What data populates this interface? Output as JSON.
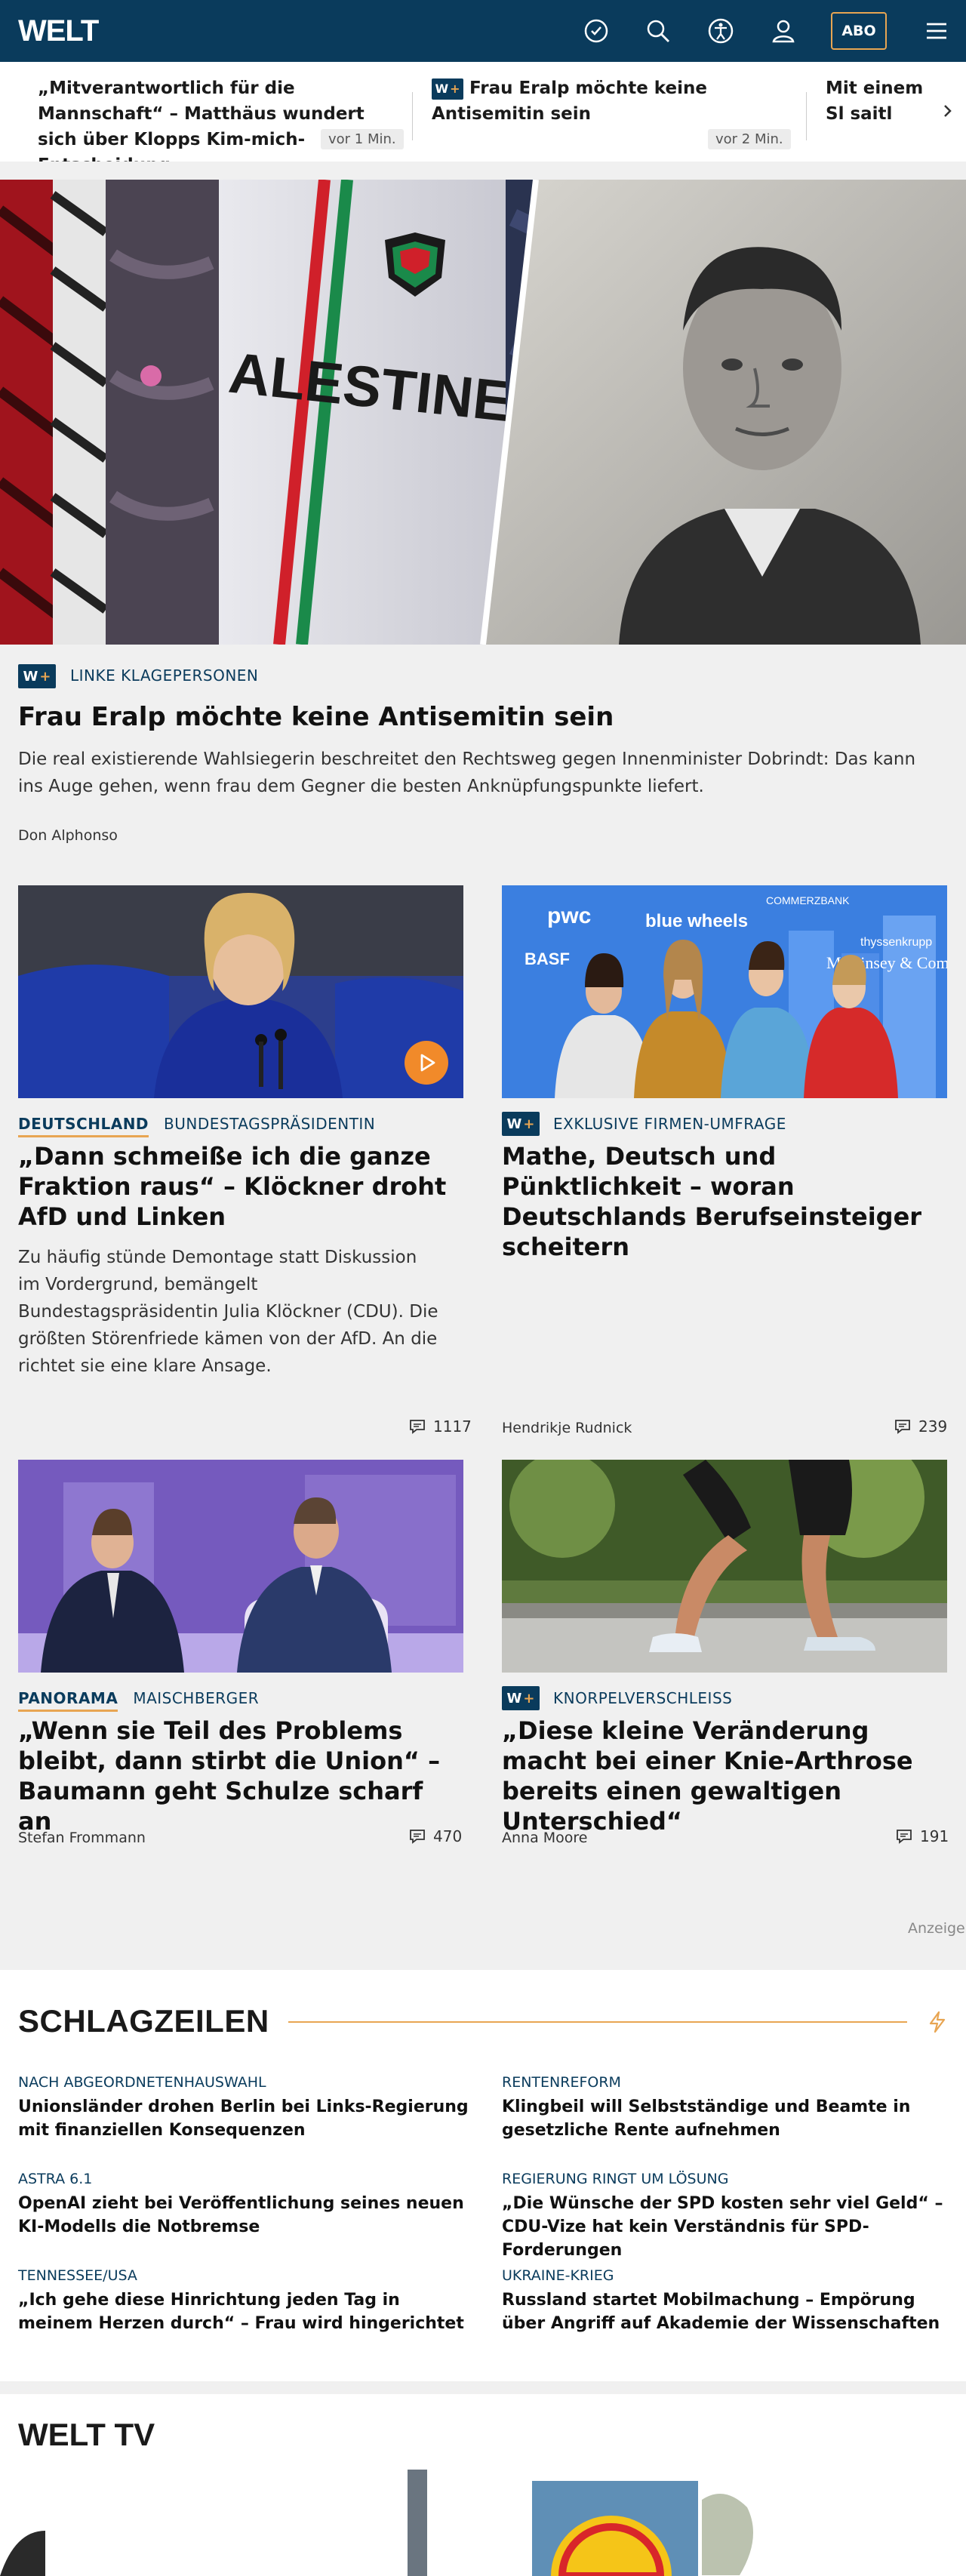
{
  "header": {
    "logo": "WELT",
    "abo_label": "ABO",
    "icons": [
      "clock-icon",
      "search-icon",
      "accessibility-icon",
      "user-icon",
      "menu-icon"
    ]
  },
  "ticker": [
    {
      "text": "„Mitverantwortlich für die Mannschaft“ – Matthäus wundert sich über Klopps Kim-mich-Entscheidung",
      "time": "vor 1 Min.",
      "premium": false
    },
    {
      "text": "Frau Eralp möchte keine Antisemitin sein",
      "time": "vor 2 Min.",
      "premium": true
    },
    {
      "text": "Mit einem Sl saitl seinen g",
      "time": "",
      "premium": false
    }
  ],
  "hero": {
    "premium_badge": "W+",
    "kicker": "LINKE KLAGEPERSONEN",
    "headline": "Frau Eralp möchte keine Antisemitin sein",
    "teaser": "Die real existierende Wahlsiegerin beschreitet den Rechtsweg gegen Innenminister Dobrindt: Das kann ins Auge gehen, wenn frau dem Gegner die besten Anknüpfungspunkte liefert.",
    "author": "Don Alphonso",
    "jersey_text": "ALESTINE"
  },
  "cards": [
    {
      "section": "DEUTSCHLAND",
      "kicker": "BUNDESTAGSPRÄSIDENTIN",
      "headline": "„Dann schmeiße ich die ganze Fraktion raus“ – Klöckner droht AfD und Linken",
      "teaser": "Zu häufig stünde Demontage statt Diskussion im Vordergrund, bemängelt Bundestagspräsidentin Julia Klöckner (CDU). Die größten Störenfriede kämen von der AfD. An die richtet sie eine klare Ansage.",
      "author": "",
      "comments": "1117",
      "video": true
    },
    {
      "section": "",
      "premium_badge": "W+",
      "kicker": "EXKLUSIVE FIRMEN-UMFRAGE",
      "headline": "Mathe, Deutsch und Pünktlichkeit – woran Deutschlands Berufseinsteiger scheitern",
      "teaser": "",
      "author": "Hendrikje Rudnick",
      "comments": "239",
      "logos": [
        "pwc",
        "blue wheels",
        "COMMERZBANK",
        "thyssenkrupp",
        "BASF",
        "McKinsey & Company"
      ]
    },
    {
      "section": "PANORAMA",
      "kicker": "MAISCHBERGER",
      "headline": "„Wenn sie Teil des Problems bleibt, dann stirbt die Union“ – Baumann geht Schulze scharf an",
      "author": "Stefan Frommann",
      "comments": "470"
    },
    {
      "section": "",
      "premium_badge": "W+",
      "kicker": "KNORPELVERSCHLEISS",
      "headline": "„Diese kleine Veränderung macht bei einer Knie-Arthrose bereits einen gewaltigen Unterschied“",
      "author": "Anna Moore",
      "comments": "191"
    }
  ],
  "ad_label": "Anzeige",
  "schlagzeilen": {
    "title": "SCHLAGZEILEN",
    "icon": "lightning-icon",
    "items": [
      {
        "kicker": "NACH ABGEORDNETENHAUSWAHL",
        "headline": "Unionsländer drohen Berlin bei Links-Regierung mit finanziellen Konsequenzen"
      },
      {
        "kicker": "RENTENREFORM",
        "headline": "Klingbeil will Selbstständige und Beamte in gesetzliche Rente aufnehmen"
      },
      {
        "kicker": "ASTRA 6.1",
        "headline": "OpenAI zieht bei Veröffentlichung seines neuen KI-Modells die Notbremse"
      },
      {
        "kicker": "REGIERUNG RINGT UM LÖSUNG",
        "headline": "„Die Wünsche der SPD kosten sehr viel Geld“ – CDU-Vize hat kein Verständnis für SPD-Forderungen"
      },
      {
        "kicker": "TENNESSEE/USA",
        "headline": "„Ich gehe diese Hinrichtung jeden Tag in meinem Herzen durch“ – Frau wird hingerichtet"
      },
      {
        "kicker": "UKRAINE-KRIEG",
        "headline": "Russland startet Mobilmachung – Empörung über Angriff auf Akademie der Wissenschaften"
      }
    ]
  },
  "welt_tv": {
    "title": "WELT TV"
  },
  "colors": {
    "brand": "#0a3b5c",
    "accent": "#e8a552",
    "video": "#f18a2a"
  }
}
